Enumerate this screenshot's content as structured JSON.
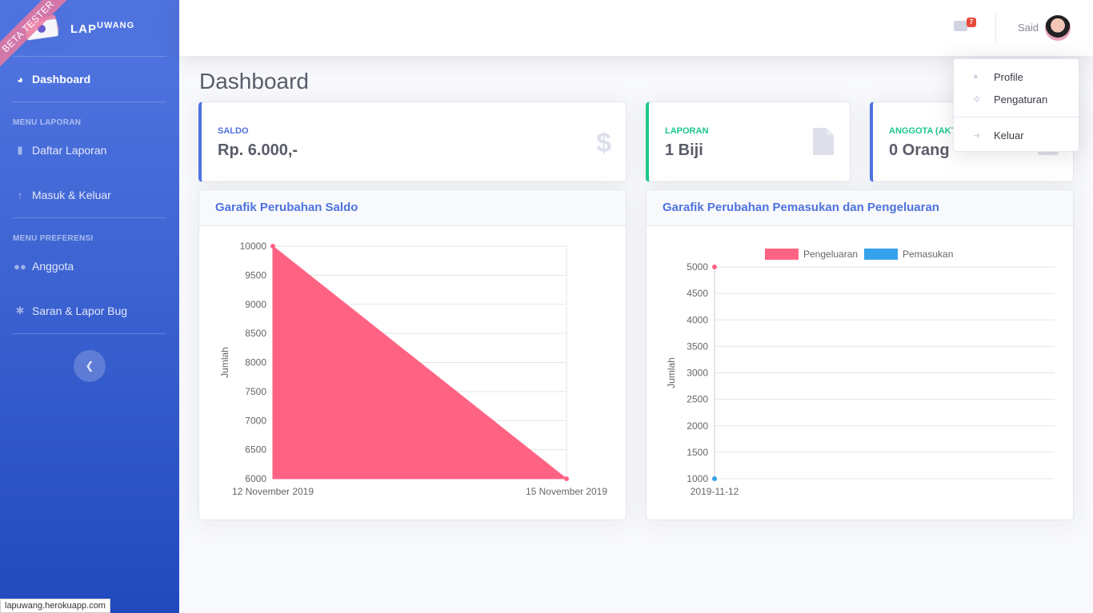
{
  "brand": {
    "name": "LAP",
    "sup": "UWANG",
    "ribbon": "BETA TESTER"
  },
  "sidebar": {
    "dashboard": "Dashboard",
    "heading_laporan": "MENU LAPORAN",
    "daftar_laporan": "Daftar Laporan",
    "masuk_keluar": "Masuk & Keluar",
    "heading_preferensi": "MENU PREFERENSI",
    "anggota": "Anggota",
    "saran": "Saran & Lapor Bug"
  },
  "topbar": {
    "mail_count": "7",
    "username": "Said"
  },
  "dropdown": {
    "profile": "Profile",
    "pengaturan": "Pengaturan",
    "keluar": "Keluar"
  },
  "page_title": "Dashboard",
  "stats": {
    "saldo": {
      "label": "Saldo",
      "value": "Rp. 6.000,-",
      "icon": "$"
    },
    "laporan": {
      "label": "Laporan",
      "value": "1 Biji"
    },
    "anggota": {
      "label": "Anggota (Aktif)",
      "value": "0 Orang"
    }
  },
  "status_bar": "lapuwang.herokuapp.com",
  "colors": {
    "primary": "#4e73df",
    "success": "#1cc88a",
    "pink": "#ff6384",
    "blue": "#36a2eb"
  },
  "chart_data": [
    {
      "type": "area",
      "title": "Garafik Perubahan Saldo",
      "ylabel": "Jumlah",
      "x": [
        "12 November 2019",
        "15 November 2019"
      ],
      "series": [
        {
          "values": [
            10000,
            6000
          ]
        }
      ],
      "ylim": [
        6000,
        10000
      ],
      "yticks": [
        10000,
        9500,
        9000,
        8500,
        8000,
        7500,
        7000,
        6500,
        6000
      ]
    },
    {
      "type": "line",
      "title": "Garafik Perubahan Pemasukan dan Pengeluaran",
      "ylabel": "Jumlah",
      "x": [
        "2019-11-12"
      ],
      "series": [
        {
          "name": "Pengeluaran",
          "values": [
            5000
          ]
        },
        {
          "name": "Pemasukan",
          "values": [
            1000
          ]
        }
      ],
      "ylim": [
        1000,
        5000
      ],
      "yticks": [
        5000,
        4500,
        4000,
        3500,
        3000,
        2500,
        2000,
        1500,
        1000
      ],
      "legend": "top"
    }
  ]
}
